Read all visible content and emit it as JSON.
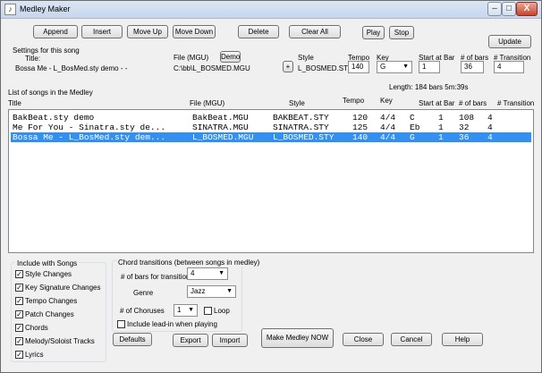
{
  "window": {
    "title": "Medley Maker",
    "close_glyph": "X"
  },
  "toolbar": {
    "append": "Append",
    "insert": "Insert",
    "move_up": "Move Up",
    "move_down": "Move Down",
    "delete": "Delete",
    "clear_all": "Clear All",
    "play": "Play",
    "stop": "Stop",
    "update": "Update"
  },
  "settings": {
    "heading": "Settings for this song",
    "title_label": "Title:",
    "title_value": "Bossa Me - L_BosMed.sty demo - -",
    "file_label": "File (MGU)",
    "demo_button": "Demo",
    "file_value": "C:\\bb\\L_BOSMED.MGU",
    "plus_button": "+",
    "style_label": "Style",
    "style_value": "L_BOSMED.STY",
    "tempo_label": "Tempo",
    "tempo_value": "140",
    "key_label": "Key",
    "key_value": "G",
    "start_label": "Start at Bar",
    "start_value": "1",
    "bars_label": "# of bars",
    "bars_value": "36",
    "transition_label": "# Transition",
    "transition_value": "4"
  },
  "list": {
    "heading": "List of songs in the Medley",
    "length_text": "Length:  184  bars   5m:39s",
    "columns": {
      "title": "Title",
      "file": "File (MGU)",
      "style": "Style",
      "tempo": "Tempo",
      "key": "Key",
      "start": "Start at Bar",
      "bars": "# of bars",
      "transition": "# Transition"
    },
    "rows": [
      {
        "title": "BakBeat.sty demo",
        "file": "BakBeat.MGU",
        "style": "BAKBEAT.STY",
        "tempo": "120",
        "sig": "4/4",
        "key": "C",
        "start": "1",
        "bars": "108",
        "transition": "4"
      },
      {
        "title": "Me For You - Sinatra.sty de...",
        "file": "SINATRA.MGU",
        "style": "SINATRA.STY",
        "tempo": "125",
        "sig": "4/4",
        "key": "Eb",
        "start": "1",
        "bars": "32",
        "transition": "4"
      },
      {
        "title": "Bossa Me - L_BosMed.sty dem...",
        "file": "L_BOSMED.MGU",
        "style": "L_BOSMED.STY",
        "tempo": "140",
        "sig": "4/4",
        "key": "G",
        "start": "1",
        "bars": "36",
        "transition": "4"
      }
    ]
  },
  "include": {
    "heading": "Include with Songs",
    "check_glyph": "✓",
    "items": [
      "Style Changes",
      "Key Signature Changes",
      "Tempo Changes",
      "Patch Changes",
      "Chords",
      "Melody/Soloist Tracks",
      "Lyrics"
    ]
  },
  "chord_transitions": {
    "heading": "Chord transitions (between songs in medley)",
    "bars_label": "# of bars for transitions",
    "bars_value": "4",
    "genre_label": "Genre",
    "genre_value": "Jazz",
    "choruses_label": "# of Choruses",
    "choruses_value": "1",
    "loop_label": "Loop",
    "leadin_label": "Include lead-in when playing"
  },
  "bottom": {
    "defaults": "Defaults",
    "export": "Export",
    "import": "Import",
    "make": "Make Medley NOW",
    "close": "Close",
    "cancel": "Cancel",
    "help": "Help"
  }
}
